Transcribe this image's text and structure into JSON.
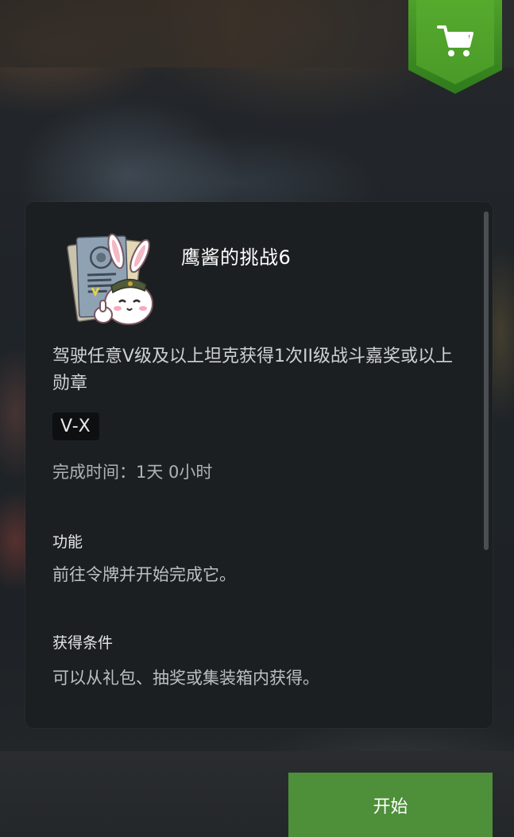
{
  "shop": {
    "icon": "shopping-cart-icon",
    "accent": "#5fb334"
  },
  "item": {
    "title": "鹰酱的挑战6",
    "description": "驾驶任意V级及以上坦克获得1次II级战斗嘉奖或以上勋章",
    "tier": "V-X",
    "completion_time": "完成时间：1天 0小时",
    "icon": "token-documents-bunny-icon"
  },
  "sections": [
    {
      "heading": "功能",
      "body": "前往令牌并开始完成它。"
    },
    {
      "heading": "获得条件",
      "body": "可以从礼包、抽奖或集装箱内获得。"
    }
  ],
  "actions": {
    "start_label": "开始",
    "start_color": "#4e8f3a"
  }
}
